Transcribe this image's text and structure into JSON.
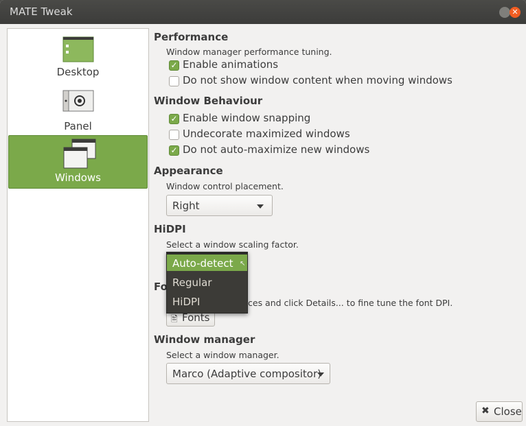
{
  "window": {
    "title": "MATE Tweak"
  },
  "sidebar": {
    "items": [
      {
        "label": "Desktop",
        "icon": "desktop-icon"
      },
      {
        "label": "Panel",
        "icon": "panel-icon"
      },
      {
        "label": "Windows",
        "icon": "windows-icon",
        "selected": true
      }
    ]
  },
  "performance": {
    "title": "Performance",
    "description": "Window manager performance tuning.",
    "options": [
      {
        "label": "Enable animations",
        "checked": true
      },
      {
        "label": "Do not show window content when moving windows",
        "checked": false
      }
    ]
  },
  "behaviour": {
    "title": "Window Behaviour",
    "options": [
      {
        "label": "Enable window snapping",
        "checked": true
      },
      {
        "label": "Undecorate maximized windows",
        "checked": false
      },
      {
        "label": "Do not auto-maximize new windows",
        "checked": true
      }
    ]
  },
  "appearance": {
    "title": "Appearance",
    "description": "Window control placement.",
    "placement_value": "Right"
  },
  "hidpi": {
    "title": "HiDPI",
    "description": "Select a window scaling factor.",
    "dropdown_options": [
      "Auto-detect",
      "Regular",
      "HiDPI"
    ],
    "highlighted": "Auto-detect"
  },
  "fonts": {
    "title_visible": "Fo",
    "description_visible": "ces and click Details... to fine tune the font DPI.",
    "button_label": "Fonts"
  },
  "window_manager": {
    "title": "Window manager",
    "description": "Select a window manager.",
    "value": "Marco (Adaptive compositor)"
  },
  "close_button": {
    "label": "Close"
  },
  "colors": {
    "accent": "#7ba94a",
    "titlebar": "#3c3c3a",
    "close": "#f15d22"
  }
}
